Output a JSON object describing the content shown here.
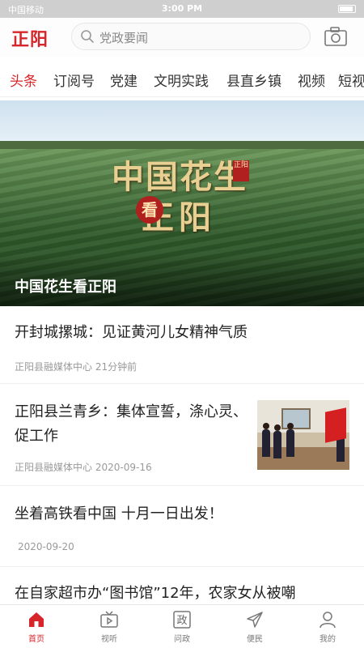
{
  "status_bar": {
    "carrier": "中国移动",
    "time": "3:00 PM"
  },
  "header": {
    "logo": "正阳",
    "search_placeholder": "党政要闻",
    "camera_icon": "camera-icon"
  },
  "tabs": [
    "头条",
    "订阅号",
    "党建",
    "文明实践",
    "县直乡镇",
    "视频",
    "短视"
  ],
  "active_tab": "头条",
  "hero": {
    "calligraphy_line1": "中国花生",
    "calligraphy_mark": "看",
    "calligraphy_line2": "正阳",
    "seal": "正阳",
    "caption": "中国花生看正阳"
  },
  "news": [
    {
      "title": "开封城摞城：见证黄河儿女精神气质",
      "source": "正阳县融媒体中心",
      "time": "21分钟前"
    },
    {
      "title": "正阳县兰青乡：集体宣誓，涤心灵、促工作",
      "source": "正阳县融媒体中心",
      "time": "2020-09-16"
    },
    {
      "title": "坐着高铁看中国 十月一日出发！",
      "source": "",
      "time": "2020-09-20"
    },
    {
      "title": "在自家超市办“图书馆”12年，农家女从被嘲",
      "source": "",
      "time": ""
    }
  ],
  "bottom_nav": [
    {
      "label": "首页",
      "icon": "home-icon"
    },
    {
      "label": "视听",
      "icon": "tv-icon"
    },
    {
      "label": "问政",
      "icon": "question-icon",
      "glyph": "政"
    },
    {
      "label": "便民",
      "icon": "send-icon"
    },
    {
      "label": "我的",
      "icon": "user-icon"
    }
  ],
  "colors": {
    "accent": "#d6262b"
  }
}
